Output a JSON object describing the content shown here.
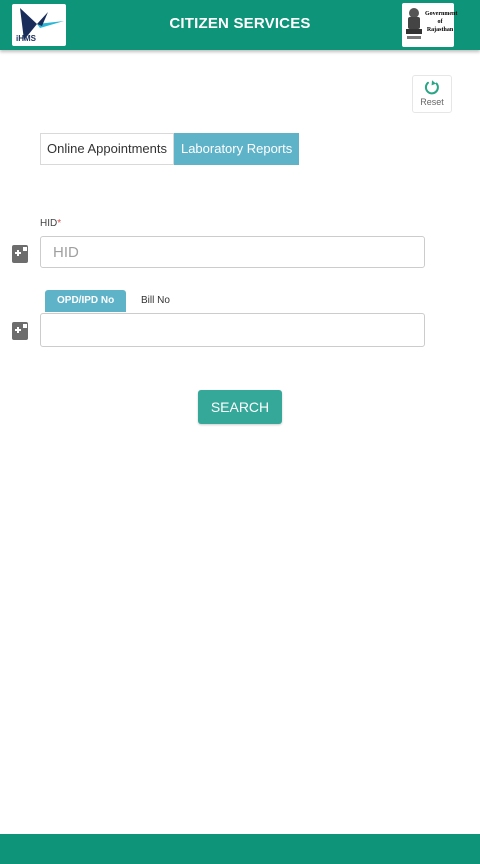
{
  "header": {
    "title": "CITIZEN SERVICES",
    "logo_text": "iHMS",
    "gov_line1": "Government",
    "gov_line2": "of",
    "gov_line3": "Rajasthan"
  },
  "reset": {
    "label": "Reset",
    "icon": "refresh-icon"
  },
  "tabs": [
    {
      "label": "Online Appointments",
      "active": false
    },
    {
      "label": "Laboratory Reports",
      "active": true
    }
  ],
  "form": {
    "hid_label": "HID",
    "hid_required_mark": "*",
    "hid_placeholder": "HID",
    "hid_value": "",
    "toggle_options": [
      {
        "label": "OPD/IPD No",
        "active": true
      },
      {
        "label": "Bill No",
        "active": false
      }
    ],
    "number_value": "",
    "search_label": "SEARCH"
  },
  "colors": {
    "brand": "#0e9479",
    "tab_active": "#5fb3c9",
    "button": "#35a89a"
  }
}
